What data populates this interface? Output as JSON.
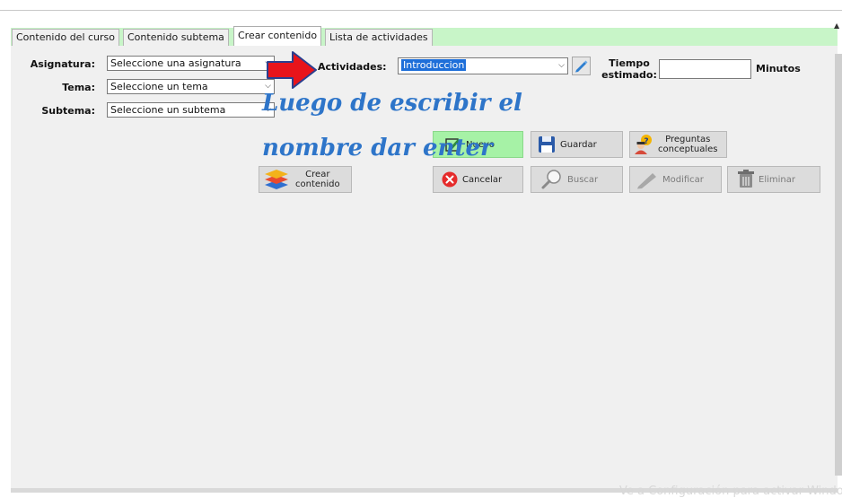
{
  "tabs": [
    {
      "label": "Contenido del curso"
    },
    {
      "label": "Contenido subtema"
    },
    {
      "label": "Crear contenido"
    },
    {
      "label": "Lista de actividades"
    }
  ],
  "active_tab": "Crear contenido",
  "form": {
    "asignatura_label": "Asignatura:",
    "asignatura_value": "Seleccione una asignatura",
    "tema_label": "Tema:",
    "tema_value": "Seleccione un tema",
    "subtema_label": "Subtema:",
    "subtema_value": "Seleccione un subtema",
    "actividades_label": "Actividades:",
    "actividades_value": "Introduccion",
    "tiempo_label_1": "Tiempo",
    "tiempo_label_2": "estimado:",
    "tiempo_value": "",
    "minutos_label": "Minutos"
  },
  "annotation": {
    "line1": "Luego de escribir el",
    "line2": "nombre dar enter",
    "arrow_color": "#e8141b"
  },
  "buttons": {
    "crear_1": "Crear",
    "crear_2": "contenido",
    "nuevo": "Nuevo",
    "guardar": "Guardar",
    "preguntas_1": "Preguntas",
    "preguntas_2": "conceptuales",
    "cancelar": "Cancelar",
    "buscar": "Buscar",
    "modificar": "Modificar",
    "eliminar": "Eliminar"
  },
  "watermark": "Ve a Configuración para activar Windows",
  "colors": {
    "tab_strip": "#c8f5c8",
    "nuevo_button": "#a6f2a6",
    "annotation_text": "#2e75c9",
    "selection": "#1e6fd9"
  }
}
